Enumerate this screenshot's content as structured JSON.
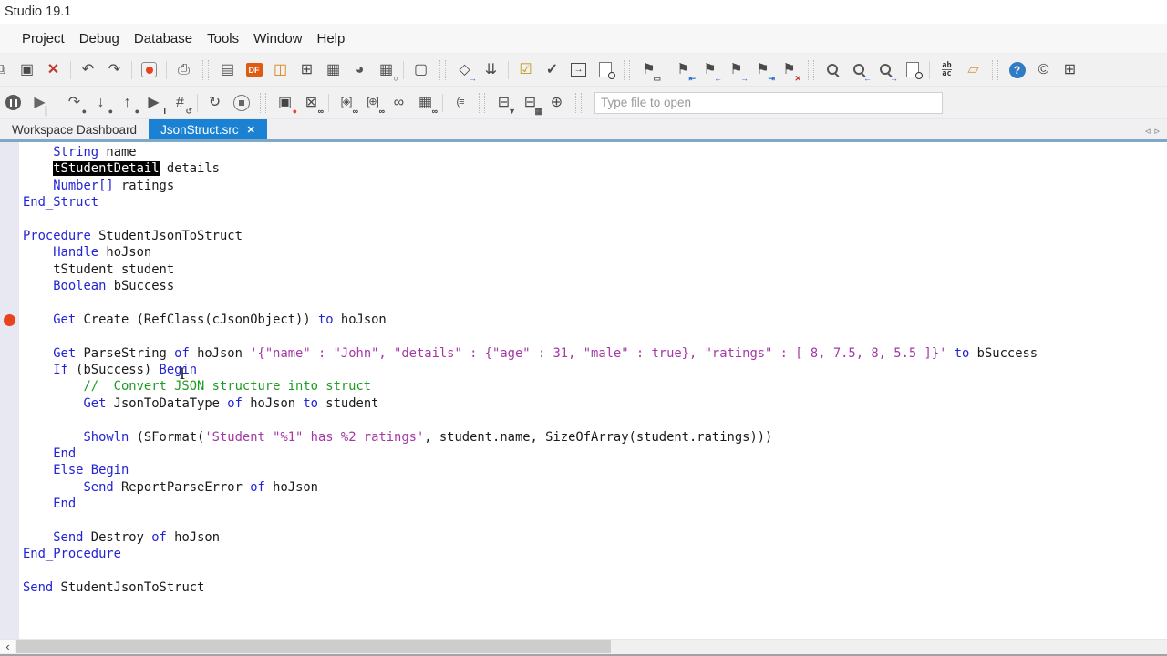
{
  "window": {
    "title": "Studio 19.1"
  },
  "menu": {
    "items": [
      "Project",
      "Debug",
      "Database",
      "Tools",
      "Window",
      "Help"
    ]
  },
  "colors": {
    "kw": "#2323d6",
    "str": "#a438a6",
    "cmt": "#1d9c22",
    "sel_bg": "#000000",
    "sel_fg": "#ffffff",
    "bp": "#e8421e",
    "tab_active": "#1b82d3",
    "accent_line": "#7fa8c6"
  },
  "toolbar_main": {
    "items": [
      {
        "kind": "icon",
        "name": "copy-icon",
        "glyph": "⧉",
        "cut": true
      },
      {
        "kind": "icon",
        "name": "paste-icon",
        "glyph": "▣"
      },
      {
        "kind": "icon",
        "name": "delete-icon",
        "glyph": "✕",
        "color": "#c0392b",
        "bold": true
      },
      {
        "kind": "sep"
      },
      {
        "kind": "icon",
        "name": "undo-icon",
        "glyph": "↶"
      },
      {
        "kind": "icon",
        "name": "redo-icon",
        "glyph": "↷"
      },
      {
        "kind": "sep"
      },
      {
        "kind": "icon",
        "name": "record-macro-icon",
        "css": "record"
      },
      {
        "kind": "sep"
      },
      {
        "kind": "icon",
        "name": "print-icon",
        "glyph": "⎙"
      },
      {
        "kind": "grip"
      },
      {
        "kind": "icon",
        "name": "workspace-dashboard-icon",
        "glyph": "▤"
      },
      {
        "kind": "icon",
        "name": "dataflex-project-icon",
        "css": "df",
        "text": "DF"
      },
      {
        "kind": "icon",
        "name": "order-entry-view-icon",
        "glyph": "◫",
        "color": "#d9831f"
      },
      {
        "kind": "icon",
        "name": "data-dictionary-icon",
        "glyph": "⊞"
      },
      {
        "kind": "icon",
        "name": "table-editor-icon",
        "glyph": "▦"
      },
      {
        "kind": "icon",
        "name": "theme-palette-icon",
        "glyph": "◕",
        "color": "#555555"
      },
      {
        "kind": "icon",
        "name": "find-table-icon",
        "glyph": "▦",
        "o": "○",
        "oc": "#333333"
      },
      {
        "kind": "sep"
      },
      {
        "kind": "icon",
        "name": "new-file-icon",
        "glyph": "▢"
      },
      {
        "kind": "grip"
      },
      {
        "kind": "icon",
        "name": "deploy-package-icon",
        "glyph": "◇",
        "o": "→",
        "oc": "#2a6fc8"
      },
      {
        "kind": "icon",
        "name": "compile-icon",
        "glyph": "⇊"
      },
      {
        "kind": "sep"
      },
      {
        "kind": "icon",
        "name": "warnings-check-icon",
        "glyph": "☑",
        "color": "#c09a1d"
      },
      {
        "kind": "icon",
        "name": "validate-checklist-icon",
        "glyph": "✓",
        "bold": true
      },
      {
        "kind": "icon",
        "name": "run-program-icon",
        "css": "boxarrow",
        "text": "→"
      },
      {
        "kind": "icon",
        "name": "code-preview-icon",
        "css": "searchdoc"
      },
      {
        "kind": "grip"
      },
      {
        "kind": "icon",
        "name": "toggle-bookmark-icon",
        "glyph": "⚑",
        "o": "▭",
        "oc": "#555555"
      },
      {
        "kind": "sep"
      },
      {
        "kind": "icon",
        "name": "first-bookmark-icon",
        "glyph": "⚑",
        "o": "⇤",
        "oc": "#2a6fc8"
      },
      {
        "kind": "icon",
        "name": "previous-bookmark-icon",
        "glyph": "⚑",
        "o": "←",
        "oc": "#2a6fc8"
      },
      {
        "kind": "icon",
        "name": "next-bookmark-icon",
        "glyph": "⚑",
        "o": "→",
        "oc": "#2a6fc8"
      },
      {
        "kind": "icon",
        "name": "last-bookmark-icon",
        "glyph": "⚑",
        "o": "⇥",
        "oc": "#2a6fc8"
      },
      {
        "kind": "icon",
        "name": "clear-bookmarks-icon",
        "glyph": "⚑",
        "o": "✕",
        "oc": "#c0392b"
      },
      {
        "kind": "grip"
      },
      {
        "kind": "icon",
        "name": "find-icon",
        "css": "search"
      },
      {
        "kind": "icon",
        "name": "find-previous-icon",
        "css": "search",
        "o": "←",
        "oc": "#2a6fc8"
      },
      {
        "kind": "icon",
        "name": "find-next-icon",
        "css": "search",
        "o": "→",
        "oc": "#2a6fc8"
      },
      {
        "kind": "icon",
        "name": "find-in-files-icon",
        "css": "searchdoc"
      },
      {
        "kind": "sep"
      },
      {
        "kind": "icon",
        "name": "replace-icon",
        "css": "replace",
        "text": "ab",
        "text2": "ac"
      },
      {
        "kind": "icon",
        "name": "replace-in-files-icon",
        "glyph": "▱",
        "color": "#cf9b43"
      },
      {
        "kind": "grip"
      },
      {
        "kind": "icon",
        "name": "help-icon",
        "css": "help",
        "text": "?"
      },
      {
        "kind": "icon",
        "name": "about-icon",
        "glyph": "©",
        "color": "#444444"
      },
      {
        "kind": "icon",
        "name": "window-layout-icon",
        "glyph": "⊞",
        "color": "#444444"
      }
    ]
  },
  "toolbar_debug": {
    "file_open_placeholder": "Type file to open",
    "items": [
      {
        "kind": "icon",
        "name": "break-all-icon",
        "css": "pausecircle"
      },
      {
        "kind": "icon",
        "name": "step-next-icon",
        "glyph": "▶",
        "color": "#666666",
        "o": "▏",
        "oc": "#555555"
      },
      {
        "kind": "sep"
      },
      {
        "kind": "icon",
        "name": "step-over-icon",
        "glyph": "↷",
        "o": "●",
        "oc": "#555555"
      },
      {
        "kind": "icon",
        "name": "step-into-icon",
        "glyph": "↓",
        "o": "●",
        "oc": "#555555"
      },
      {
        "kind": "icon",
        "name": "step-out-icon",
        "glyph": "↑",
        "o": "●",
        "oc": "#555555"
      },
      {
        "kind": "icon",
        "name": "run-to-cursor-icon",
        "glyph": "▶",
        "color": "#555555",
        "o": "I",
        "oc": "#333333"
      },
      {
        "kind": "icon",
        "name": "set-next-statement-icon",
        "glyph": "#",
        "o": "↺",
        "oc": "#555555"
      },
      {
        "kind": "sep"
      },
      {
        "kind": "icon",
        "name": "restart-debug-icon",
        "glyph": "↻"
      },
      {
        "kind": "icon",
        "name": "stop-debug-icon",
        "css": "stop"
      },
      {
        "kind": "grip"
      },
      {
        "kind": "icon",
        "name": "toggle-breakpoint-icon",
        "glyph": "▣",
        "color": "#444444",
        "o": "●",
        "oc": "#e8421e"
      },
      {
        "kind": "icon",
        "name": "breakpoints-window-icon",
        "glyph": "⊠",
        "o": "∞",
        "oc": "#333333"
      },
      {
        "kind": "sep"
      },
      {
        "kind": "icon",
        "name": "watch-expression-icon",
        "glyph": "[◈]",
        "small": true,
        "o": "∞",
        "oc": "#333333"
      },
      {
        "kind": "icon",
        "name": "global-watch-icon",
        "glyph": "[⊕]",
        "small": true,
        "o": "∞",
        "oc": "#333333"
      },
      {
        "kind": "icon",
        "name": "locals-window-icon",
        "glyph": "∞"
      },
      {
        "kind": "icon",
        "name": "table-watch-icon",
        "glyph": "▦",
        "o": "∞",
        "oc": "#333333"
      },
      {
        "kind": "sep"
      },
      {
        "kind": "icon",
        "name": "call-stack-icon",
        "glyph": "(≡",
        "small": true
      },
      {
        "kind": "grip"
      },
      {
        "kind": "icon",
        "name": "database-explorer-icon",
        "glyph": "⊟",
        "o": "▼",
        "oc": "#555555"
      },
      {
        "kind": "icon",
        "name": "database-builder-icon",
        "glyph": "⊟",
        "o": "▦",
        "oc": "#555555"
      },
      {
        "kind": "icon",
        "name": "web-database-icon",
        "glyph": "⊕"
      },
      {
        "kind": "grip"
      }
    ]
  },
  "tabs": {
    "items": [
      {
        "label": "Workspace Dashboard",
        "active": false
      },
      {
        "label": "JsonStruct.src",
        "active": true,
        "close_glyph": "✕"
      }
    ],
    "scroll_left": "◃",
    "scroll_right": "▹"
  },
  "editor": {
    "lines": [
      {
        "segs": [
          [
            "    ",
            "p"
          ],
          [
            "String",
            "k"
          ],
          [
            " name",
            "p"
          ]
        ]
      },
      {
        "segs": [
          [
            "    ",
            "p"
          ],
          [
            "tStudentDetail",
            "sel"
          ],
          [
            " details",
            "p"
          ]
        ]
      },
      {
        "segs": [
          [
            "    ",
            "p"
          ],
          [
            "Number[]",
            "k"
          ],
          [
            " ratings",
            "p"
          ]
        ]
      },
      {
        "segs": [
          [
            "End_Struct",
            "k"
          ]
        ]
      },
      {
        "segs": []
      },
      {
        "segs": [
          [
            "Procedure",
            "k"
          ],
          [
            " StudentJsonToStruct",
            "p"
          ]
        ]
      },
      {
        "segs": [
          [
            "    ",
            "p"
          ],
          [
            "Handle",
            "k"
          ],
          [
            " hoJson",
            "p"
          ]
        ]
      },
      {
        "segs": [
          [
            "    tStudent student",
            "p"
          ]
        ]
      },
      {
        "segs": [
          [
            "    ",
            "p"
          ],
          [
            "Boolean",
            "k"
          ],
          [
            " bSuccess",
            "p"
          ]
        ]
      },
      {
        "segs": []
      },
      {
        "bp": true,
        "segs": [
          [
            "    ",
            "p"
          ],
          [
            "Get",
            "k"
          ],
          [
            " Create (RefClass(cJsonObject)) ",
            "p"
          ],
          [
            "to",
            "k"
          ],
          [
            " hoJson",
            "p"
          ]
        ]
      },
      {
        "segs": []
      },
      {
        "segs": [
          [
            "    ",
            "p"
          ],
          [
            "Get",
            "k"
          ],
          [
            " ParseString ",
            "p"
          ],
          [
            "of",
            "k"
          ],
          [
            " hoJson ",
            "p"
          ],
          [
            "'{\"name\" : \"John\", \"details\" : {\"age\" : 31, \"male\" : true}, \"ratings\" : [ 8, 7.5, 8, 5.5 ]}'",
            "s"
          ],
          [
            " ",
            "p"
          ],
          [
            "to",
            "k"
          ],
          [
            " bSuccess",
            "p"
          ]
        ]
      },
      {
        "segs": [
          [
            "    ",
            "p"
          ],
          [
            "If",
            "k"
          ],
          [
            " (bSuccess) ",
            "p"
          ],
          [
            "Begin",
            "k"
          ]
        ]
      },
      {
        "segs": [
          [
            "        ",
            "p"
          ],
          [
            "//  Convert JSON structure into struct",
            "c"
          ]
        ]
      },
      {
        "segs": [
          [
            "        ",
            "p"
          ],
          [
            "Get",
            "k"
          ],
          [
            " JsonToDataType ",
            "p"
          ],
          [
            "of",
            "k"
          ],
          [
            " hoJson ",
            "p"
          ],
          [
            "to",
            "k"
          ],
          [
            " student",
            "p"
          ]
        ]
      },
      {
        "segs": []
      },
      {
        "segs": [
          [
            "        ",
            "p"
          ],
          [
            "Showln",
            "k"
          ],
          [
            " (SFormat(",
            "p"
          ],
          [
            "'Student \"%1\" has %2 ratings'",
            "s"
          ],
          [
            ", student.name, SizeOfArray(student.ratings)))",
            "p"
          ]
        ]
      },
      {
        "segs": [
          [
            "    ",
            "p"
          ],
          [
            "End",
            "k"
          ]
        ]
      },
      {
        "segs": [
          [
            "    ",
            "p"
          ],
          [
            "Else Begin",
            "k"
          ]
        ]
      },
      {
        "segs": [
          [
            "        ",
            "p"
          ],
          [
            "Send",
            "k"
          ],
          [
            " ReportParseError ",
            "p"
          ],
          [
            "of",
            "k"
          ],
          [
            " hoJson",
            "p"
          ]
        ]
      },
      {
        "segs": [
          [
            "    ",
            "p"
          ],
          [
            "End",
            "k"
          ]
        ]
      },
      {
        "segs": []
      },
      {
        "segs": [
          [
            "    ",
            "p"
          ],
          [
            "Send",
            "k"
          ],
          [
            " Destroy ",
            "p"
          ],
          [
            "of",
            "k"
          ],
          [
            " hoJson",
            "p"
          ]
        ]
      },
      {
        "segs": [
          [
            "End_Procedure",
            "k"
          ]
        ]
      },
      {
        "segs": []
      },
      {
        "segs": [
          [
            "Send",
            "k"
          ],
          [
            " StudentJsonToStruct",
            "p"
          ]
        ]
      }
    ]
  },
  "scrollbar": {
    "left_arrow": "‹"
  },
  "cursor": {
    "ibeam_glyph": "I"
  }
}
